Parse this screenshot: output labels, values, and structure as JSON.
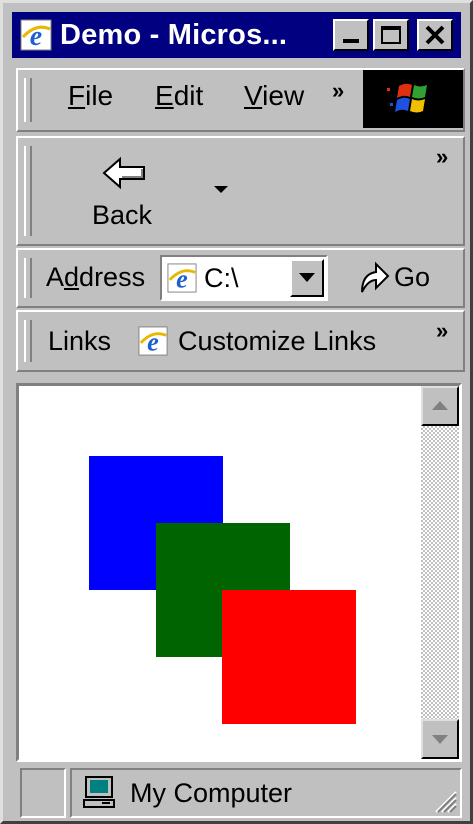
{
  "window": {
    "title": "Demo - Micros...",
    "controls": {
      "minimize": "minimize",
      "maximize": "maximize",
      "close": "close"
    }
  },
  "menu": {
    "items": [
      {
        "label": "File",
        "accel": "F",
        "rest": "ile"
      },
      {
        "label": "Edit",
        "accel": "E",
        "rest": "dit"
      },
      {
        "label": "View",
        "accel": "V",
        "rest": "iew"
      }
    ],
    "overflow": "»"
  },
  "toolbar": {
    "back_label": "Back",
    "overflow": "»"
  },
  "address": {
    "label_pre": "A",
    "label_accel": "d",
    "label_post": "dress",
    "value": "C:\\",
    "go_label": "Go"
  },
  "links": {
    "label": "Links",
    "customize": "Customize Links",
    "overflow": "»"
  },
  "content": {
    "squares": [
      {
        "name": "blue-square",
        "color": "#0000ff"
      },
      {
        "name": "green-square",
        "color": "#006400"
      },
      {
        "name": "red-square",
        "color": "#ff0000"
      }
    ]
  },
  "status": {
    "zone": "My Computer"
  },
  "icons": [
    "ie-icon",
    "windows-logo-icon",
    "back-arrow-icon",
    "dropdown-arrow-icon",
    "go-arrow-icon",
    "computer-icon",
    "resize-grip-icon",
    "scroll-up-icon",
    "scroll-down-icon"
  ]
}
